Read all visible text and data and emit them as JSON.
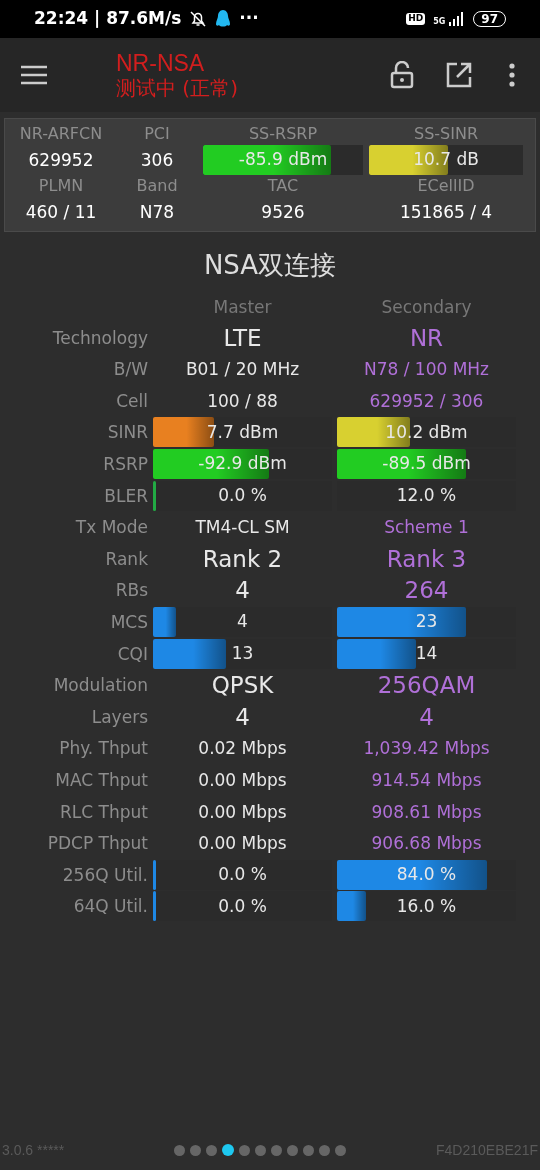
{
  "status_bar": {
    "time": "22:24 | 87.6M/s",
    "more": "···",
    "hd": "HD",
    "network": "5G",
    "battery": "97"
  },
  "app_bar": {
    "title": "NR-NSA",
    "subtitle": "测试中 (正常)"
  },
  "summary": {
    "rows": [
      {
        "headers": [
          "NR-ARFCN",
          "PCI",
          "SS-RSRP",
          "SS-SINR"
        ],
        "cells": [
          {
            "kind": "text",
            "value": "629952"
          },
          {
            "kind": "text",
            "value": "306"
          },
          {
            "kind": "bar",
            "value": "-85.9 dBm",
            "level": 0.8,
            "color": "#22cc22"
          },
          {
            "kind": "bar",
            "value": "10.7 dB",
            "level": 0.51,
            "color": "#d8d030"
          }
        ]
      },
      {
        "headers": [
          "PLMN",
          "Band",
          "TAC",
          "ECellID"
        ],
        "cells": [
          {
            "kind": "text",
            "value": "460 / 11"
          },
          {
            "kind": "text",
            "value": "N78"
          },
          {
            "kind": "text",
            "value": "9526"
          },
          {
            "kind": "text",
            "value": "151865 / 4"
          }
        ]
      }
    ]
  },
  "section_title": "NSA双连接",
  "columns": [
    "Master",
    "Secondary"
  ],
  "rows": [
    {
      "label": "Technology",
      "kind": "big",
      "master": {
        "value": "LTE"
      },
      "secondary": {
        "value": "NR"
      }
    },
    {
      "label": "B/W",
      "kind": "text",
      "master": {
        "value": "B01 / 20 MHz"
      },
      "secondary": {
        "value": "N78 / 100 MHz"
      }
    },
    {
      "label": "Cell",
      "kind": "text",
      "master": {
        "value": "100 / 88"
      },
      "secondary": {
        "value": "629952 / 306"
      }
    },
    {
      "label": "SINR",
      "kind": "bar",
      "master": {
        "value": "7.7 dBm",
        "level": 0.34,
        "color": "#e88020"
      },
      "secondary": {
        "value": "10.2 dBm",
        "level": 0.41,
        "color": "#d8d030"
      }
    },
    {
      "label": "RSRP",
      "kind": "bar",
      "master": {
        "value": "-92.9 dBm",
        "level": 0.65,
        "color": "#22cc22"
      },
      "secondary": {
        "value": "-89.5 dBm",
        "level": 0.72,
        "color": "#22cc22"
      }
    },
    {
      "label": "BLER",
      "kind": "bar",
      "master": {
        "value": "0.0 %",
        "level": 0.01,
        "color": "#22aa44"
      },
      "secondary": {
        "value": "12.0 %"
      }
    },
    {
      "label": "Tx Mode",
      "kind": "text",
      "master": {
        "value": "TM4-CL SM"
      },
      "secondary": {
        "value": "Scheme 1"
      }
    },
    {
      "label": "Rank",
      "kind": "big",
      "master": {
        "value": "Rank 2"
      },
      "secondary": {
        "value": "Rank 3"
      }
    },
    {
      "label": "RBs",
      "kind": "big",
      "master": {
        "value": "4"
      },
      "secondary": {
        "value": "264"
      }
    },
    {
      "label": "MCS",
      "kind": "bar",
      "master": {
        "value": "4",
        "level": 0.13,
        "color": "#1e88e5"
      },
      "secondary": {
        "value": "23",
        "level": 0.72,
        "color": "#1e88e5"
      }
    },
    {
      "label": "CQI",
      "kind": "bar",
      "master": {
        "value": "13",
        "level": 0.41,
        "color": "#1e88e5"
      },
      "secondary": {
        "value": "14",
        "level": 0.44,
        "color": "#1e88e5"
      }
    },
    {
      "label": "Modulation",
      "kind": "big",
      "master": {
        "value": "QPSK"
      },
      "secondary": {
        "value": "256QAM"
      }
    },
    {
      "label": "Layers",
      "kind": "big",
      "master": {
        "value": "4"
      },
      "secondary": {
        "value": "4"
      }
    },
    {
      "label": "Phy. Thput",
      "kind": "text",
      "master": {
        "value": "0.02 Mbps"
      },
      "secondary": {
        "value": "1,039.42 Mbps"
      }
    },
    {
      "label": "MAC Thput",
      "kind": "text",
      "master": {
        "value": "0.00 Mbps"
      },
      "secondary": {
        "value": "914.54 Mbps"
      }
    },
    {
      "label": "RLC Thput",
      "kind": "text",
      "master": {
        "value": "0.00 Mbps"
      },
      "secondary": {
        "value": "908.61 Mbps"
      }
    },
    {
      "label": "PDCP Thput",
      "kind": "text",
      "master": {
        "value": "0.00 Mbps"
      },
      "secondary": {
        "value": "906.68 Mbps"
      }
    },
    {
      "label": "256Q Util.",
      "kind": "bar",
      "master": {
        "value": "0.0 %",
        "level": 0.01,
        "color": "#1e88e5"
      },
      "secondary": {
        "value": "84.0 %",
        "level": 0.84,
        "color": "#1e88e5"
      }
    },
    {
      "label": "64Q Util.",
      "kind": "bar",
      "master": {
        "value": "0.0 %",
        "level": 0.01,
        "color": "#1e88e5"
      },
      "secondary": {
        "value": "16.0 %",
        "level": 0.16,
        "color": "#1e88e5"
      }
    }
  ],
  "footer": {
    "version": "3.0.6 *****",
    "pages": [
      {
        "selected": false
      },
      {
        "selected": false
      },
      {
        "selected": false
      },
      {
        "selected": true
      },
      {
        "selected": false
      },
      {
        "selected": false
      },
      {
        "selected": false
      },
      {
        "selected": false
      },
      {
        "selected": false
      },
      {
        "selected": false
      },
      {
        "selected": false
      }
    ],
    "device_id": "F4D210EBE21F"
  }
}
